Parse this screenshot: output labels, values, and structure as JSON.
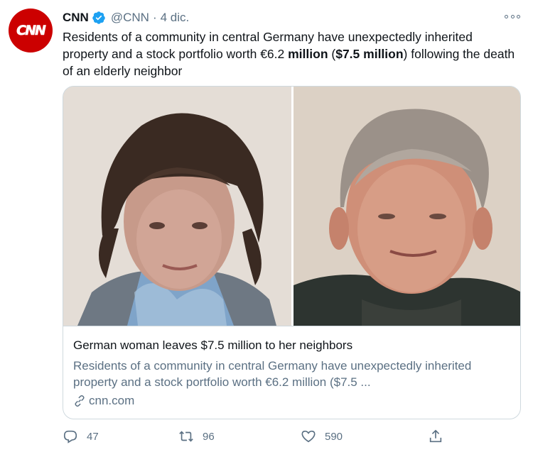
{
  "author": {
    "avatar_text": "CNN",
    "name": "CNN",
    "handle": "@CNN",
    "separator": "·",
    "time": "4 dic.",
    "brand_color": "#cc0000",
    "verified_color": "#1da1f2"
  },
  "tweet": {
    "text_prefix": "Residents of a community in central Germany have unexpectedly inherited property and a stock portfolio worth €6.2 ",
    "text_bold1": "million",
    "text_middle": " (",
    "text_bold2": "$7.5 million",
    "text_suffix": ") following the death of an elderly neighbor"
  },
  "card": {
    "title": "German woman leaves $7.5 million to her neighbors",
    "description": "Residents of a community in central Germany have unexpectedly inherited property and a stock portfolio worth €6.2 million ($7.5 ...",
    "domain": "cnn.com",
    "image_left_label": "elderly-woman-photo",
    "image_right_label": "elderly-man-photo"
  },
  "actions": {
    "replies": "47",
    "retweets": "96",
    "likes": "590",
    "icons": [
      "reply-icon",
      "retweet-icon",
      "like-icon",
      "share-icon"
    ]
  }
}
